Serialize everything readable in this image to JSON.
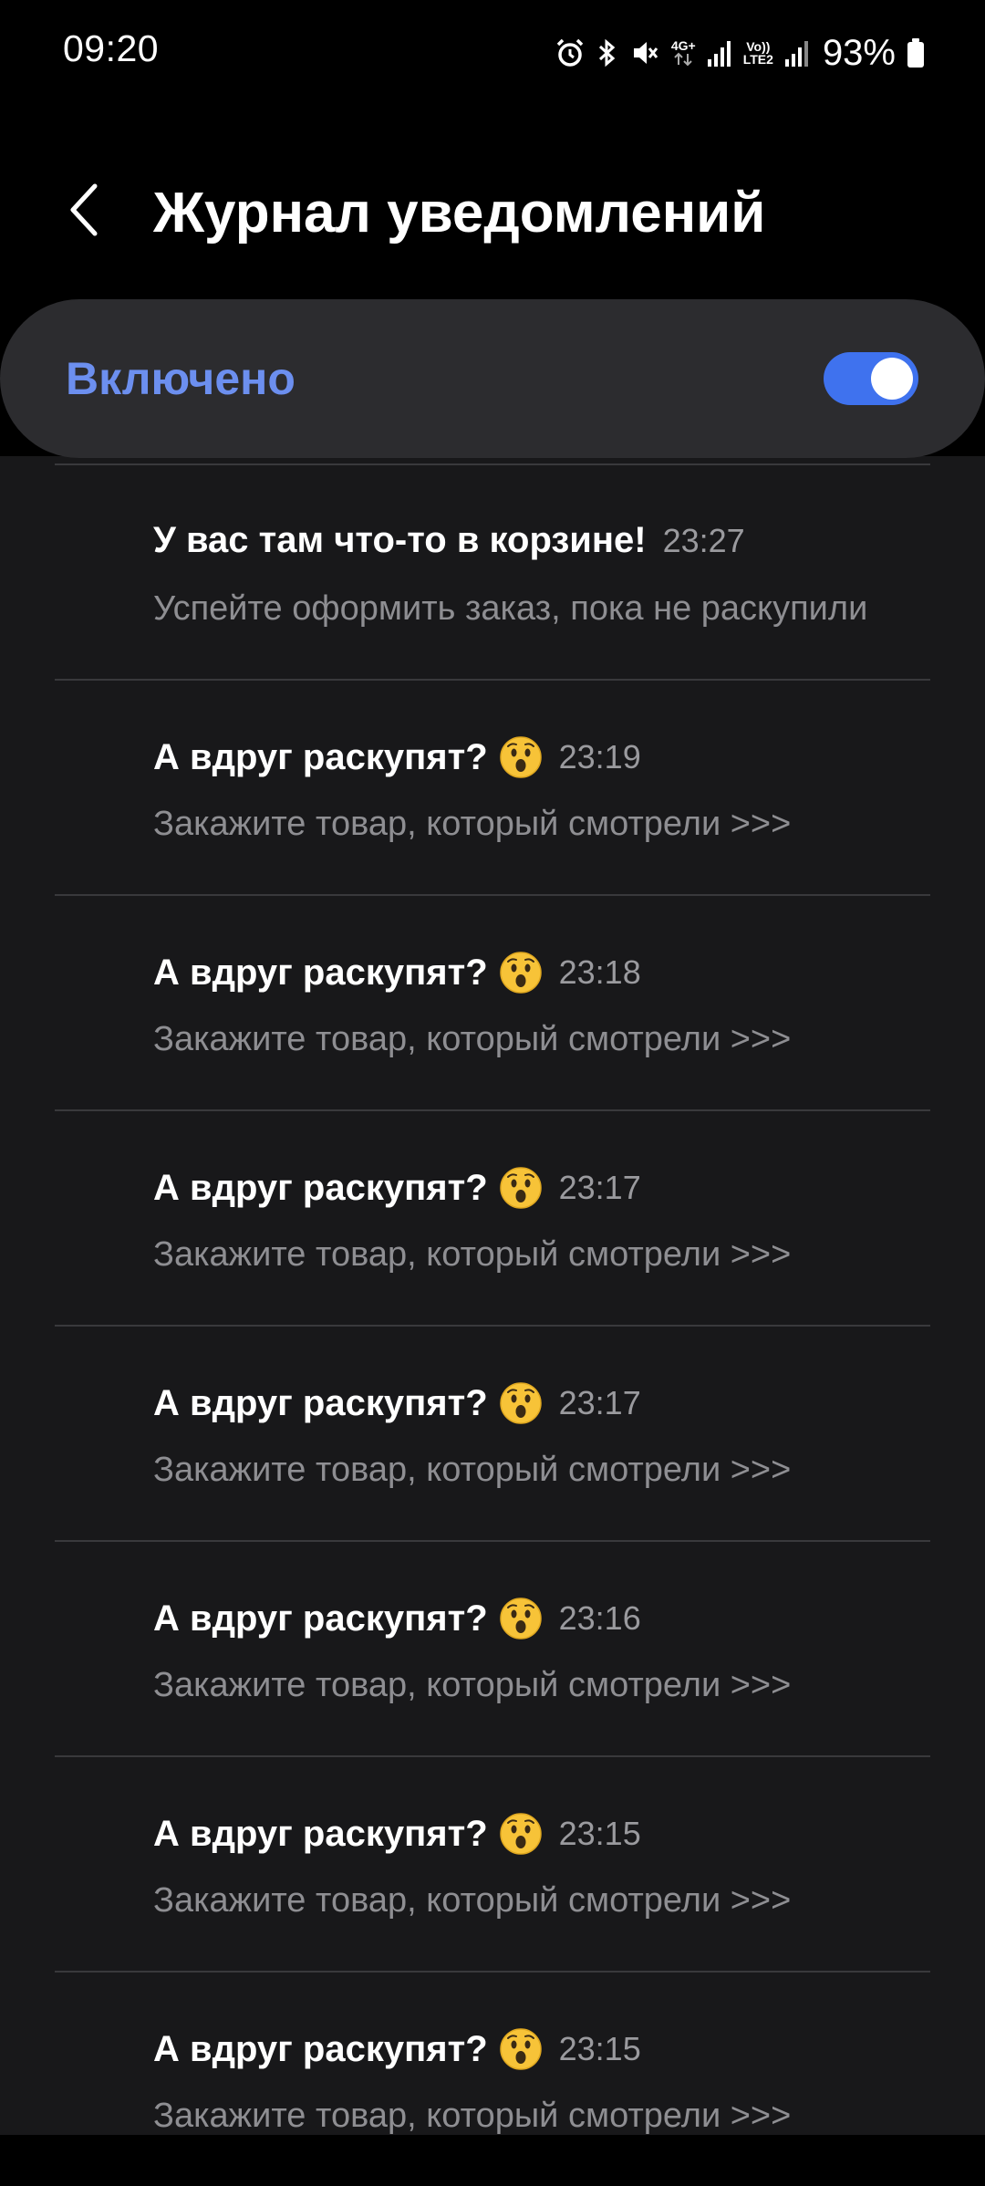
{
  "status_bar": {
    "time": "09:20",
    "network_label_top": "4G+",
    "volte_label_top": "Vo))",
    "volte_label_bottom": "LTE2",
    "battery": "93%",
    "icons": [
      "alarm-icon",
      "bluetooth-icon",
      "mute-icon",
      "network-4g-icon",
      "signal-icon",
      "volte-icon",
      "signal-icon",
      "battery-icon"
    ]
  },
  "header": {
    "title": "Журнал уведомлений",
    "back_icon": "chevron-left-icon"
  },
  "master_switch": {
    "label": "Включено",
    "enabled": true,
    "accent_color": "#3f72ee",
    "label_color": "#6c8fef"
  },
  "notifications": [
    {
      "title": "У вас там что-то в корзине!",
      "emoji": false,
      "time": "23:27",
      "body": "Успейте оформить заказ, пока не раскупили"
    },
    {
      "title": "А вдруг раскупят?",
      "emoji": true,
      "time": "23:19",
      "body": "Закажите товар, который смотрели >>>"
    },
    {
      "title": "А вдруг раскупят?",
      "emoji": true,
      "time": "23:18",
      "body": "Закажите товар, который смотрели >>>"
    },
    {
      "title": "А вдруг раскупят?",
      "emoji": true,
      "time": "23:17",
      "body": "Закажите товар, который смотрели >>>"
    },
    {
      "title": "А вдруг раскупят?",
      "emoji": true,
      "time": "23:17",
      "body": "Закажите товар, который смотрели >>>"
    },
    {
      "title": "А вдруг раскупят?",
      "emoji": true,
      "time": "23:16",
      "body": "Закажите товар, который смотрели >>>"
    },
    {
      "title": "А вдруг раскупят?",
      "emoji": true,
      "time": "23:15",
      "body": "Закажите товар, который смотрели >>>"
    },
    {
      "title": "А вдруг раскупят?",
      "emoji": true,
      "time": "23:15",
      "body": "Закажите товар, который смотрели >>>"
    }
  ]
}
